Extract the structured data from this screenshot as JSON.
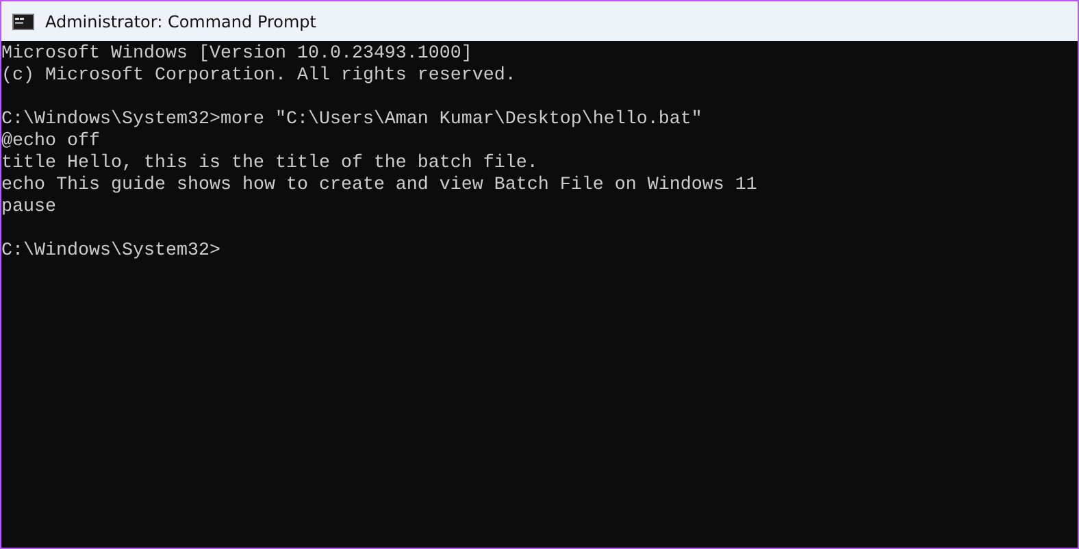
{
  "window": {
    "title": "Administrator: Command Prompt"
  },
  "console": {
    "blocks": [
      [
        "Microsoft Windows [Version 10.0.23493.1000]",
        "(c) Microsoft Corporation. All rights reserved."
      ],
      [
        "C:\\Windows\\System32>more \"C:\\Users\\Aman Kumar\\Desktop\\hello.bat\"",
        "@echo off",
        "title Hello, this is the title of the batch file.",
        "echo This guide shows how to create and view Batch File on Windows 11",
        "pause"
      ],
      [
        "C:\\Windows\\System32>"
      ]
    ]
  }
}
